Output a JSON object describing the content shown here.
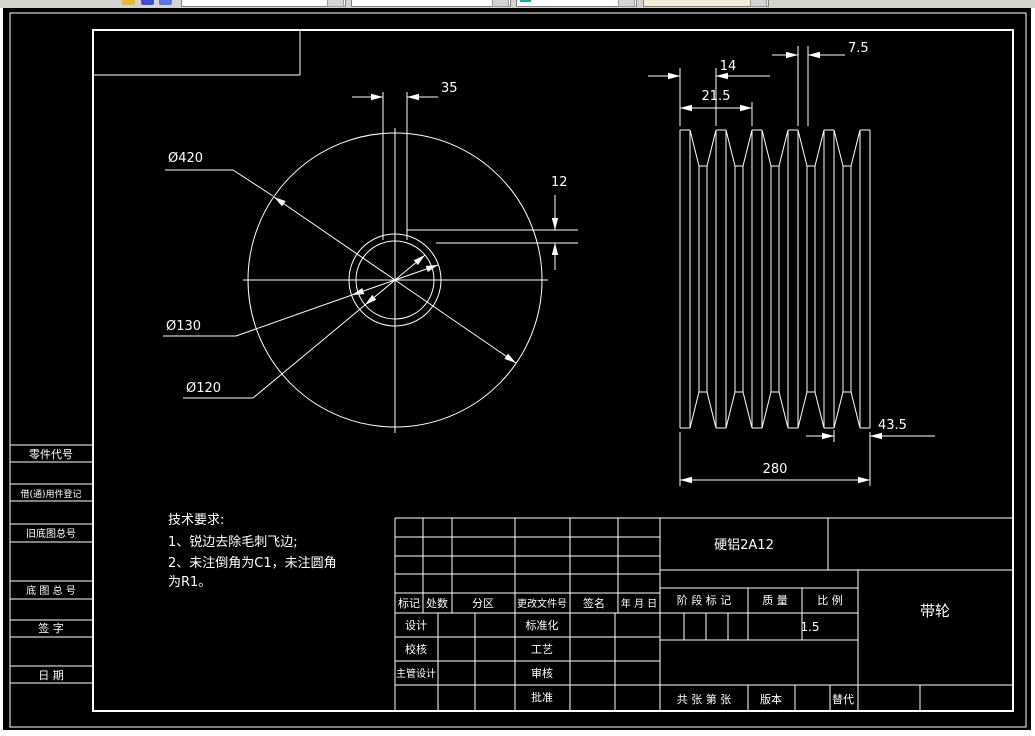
{
  "colors": {
    "canvas_bg": "#000000",
    "line_color": "#ffffff",
    "toolbar_bg": "#d6d3ce"
  },
  "views": {
    "front_view": {
      "dims": {
        "width_35": "35",
        "depth_12": "12",
        "dia_outer": "Ø420",
        "dia_hub": "Ø130",
        "dia_bore": "Ø120"
      }
    },
    "side_view": {
      "dims": {
        "d14": "14",
        "d21_5": "21.5",
        "d7_5": "7.5",
        "d43_5": "43.5",
        "d280": "280"
      }
    }
  },
  "tech_requirements": {
    "title": "技术要求:",
    "lines": [
      "1、锐边去除毛刺飞边;",
      "2、未注倒角为C1，未注圆角",
      "为R1。"
    ]
  },
  "margin_labels": [
    "零件代号",
    "借(通)用件登记",
    "旧底图总号",
    "底 图 总 号",
    "签  字",
    "日  期"
  ],
  "title_block": {
    "material": "硬铝2A12",
    "part_name": "带轮",
    "col_headers": [
      "标记",
      "处数",
      "分区",
      "更改文件号",
      "签名",
      "年 月 日"
    ],
    "rows_left": [
      "设计",
      "校核",
      "主管设计"
    ],
    "rows_right": [
      "标准化",
      "工艺",
      "审核",
      "批准"
    ],
    "stage_label": "阶 段 标 记",
    "mass_label": "质 量",
    "scale_label": "比 例",
    "scale_value": "1.5",
    "sheet_info": "共  张  第  张",
    "version_label": "版本",
    "substitute_label": "替代"
  }
}
